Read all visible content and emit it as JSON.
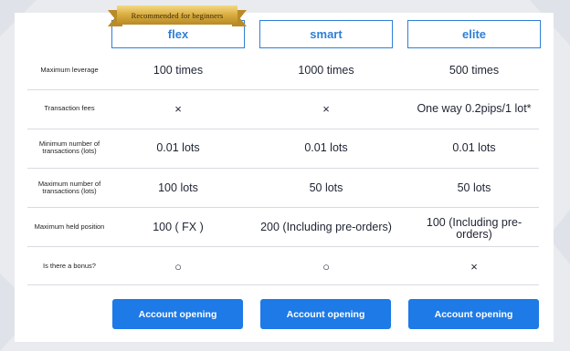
{
  "ribbon_label": "Recommended for beginners",
  "plans": [
    "flex",
    "smart",
    "elite"
  ],
  "rows": [
    {
      "label": "Maximum leverage",
      "values": [
        "100 times",
        "1000 times",
        "500 times"
      ]
    },
    {
      "label": "Transaction fees",
      "values": [
        "×",
        "×",
        "One way 0.2pips/1 lot*"
      ]
    },
    {
      "label": "Minimum number of transactions (lots)",
      "values": [
        "0.01 lots",
        "0.01 lots",
        "0.01 lots"
      ]
    },
    {
      "label": "Maximum number of transactions (lots)",
      "values": [
        "100 lots",
        "50 lots",
        "50 lots"
      ]
    },
    {
      "label": "Maximum held position",
      "values": [
        "100 ( FX )",
        "200 (Including pre-orders)",
        "100 (Including pre-orders)"
      ]
    },
    {
      "label": "Is there a bonus?",
      "values": [
        "○",
        "○",
        "×"
      ]
    }
  ],
  "buttons": [
    "Account opening",
    "Account opening",
    "Account opening"
  ],
  "colors": {
    "accent": "#1d7ae6",
    "header_border": "#2f7fd6",
    "ribbon": "#d8ac3f",
    "background": "#e9ebef"
  }
}
